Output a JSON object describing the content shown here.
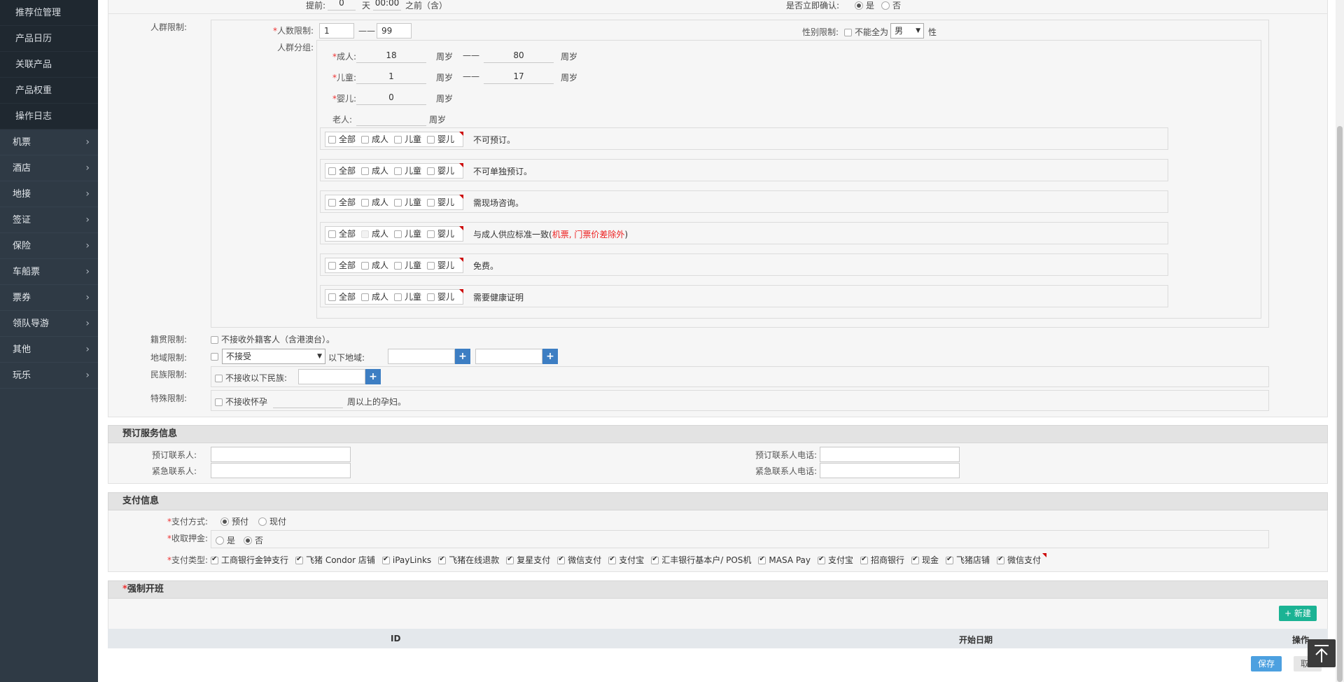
{
  "sidebar": {
    "sub_items": [
      "推荐位管理",
      "产品日历",
      "关联产品",
      "产品权重",
      "操作日志"
    ],
    "menu_items": [
      "机票",
      "酒店",
      "地接",
      "签证",
      "保险",
      "车船票",
      "票券",
      "领队导游",
      "其他",
      "玩乐"
    ],
    "chevron": "›"
  },
  "top_partial": {
    "advance_label": "提前:",
    "advance_days": "0",
    "day_unit": "天",
    "advance_time": "00:00",
    "before_text": "之前（含）",
    "confirm_label": "是否立即确认:",
    "yes": "是",
    "no": "否"
  },
  "crowd": {
    "label": "人群限制:",
    "people_limit_label": "人数限制:",
    "min": "1",
    "dash": "——",
    "max": "99",
    "gender_label": "性别限制:",
    "gender_text": "不能全为",
    "gender_value": "男",
    "gender_suffix": "性",
    "group_label": "人群分组:",
    "unit": "周岁",
    "groups": [
      {
        "label": "成人:",
        "from": "18",
        "to": "80",
        "required": true
      },
      {
        "label": "儿童:",
        "from": "1",
        "to": "17",
        "required": true
      },
      {
        "label": "婴儿:",
        "from": "0",
        "to": "",
        "required": true
      },
      {
        "label": "老人:",
        "from": "",
        "to": "",
        "required": false
      }
    ],
    "options": [
      "全部",
      "成人",
      "儿童",
      "婴儿"
    ],
    "rules": [
      {
        "text": "不可预订。",
        "extra": ""
      },
      {
        "text": "不可单独预订。",
        "extra": ""
      },
      {
        "text": "需现场咨询。",
        "extra": ""
      },
      {
        "text": "与成人供应标准一致(",
        "extra": "机票, 门票价差除外",
        "close": ")"
      },
      {
        "text": "免费。",
        "extra": ""
      },
      {
        "text": "需要健康证明",
        "extra": ""
      }
    ]
  },
  "nationality": {
    "label": "籍贯限制:",
    "text": "不接收外籍客人（含港澳台）。"
  },
  "region": {
    "label": "地域限制:",
    "select": "不接受",
    "text": "以下地域:"
  },
  "ethnic": {
    "label": "民族限制:",
    "text": "不接收以下民族:"
  },
  "special": {
    "label": "特殊限制:",
    "text": "不接收怀孕",
    "suffix": "周以上的孕妇。"
  },
  "booking": {
    "title": "预订服务信息",
    "contact_label": "预订联系人:",
    "emergency_label": "紧急联系人:",
    "contact_phone_label": "预订联系人电话:",
    "emergency_phone_label": "紧急联系人电话:"
  },
  "payment": {
    "title": "支付信息",
    "method_label": "支付方式:",
    "method_prepay": "预付",
    "method_cash": "现付",
    "deposit_label": "收取押金:",
    "deposit_yes": "是",
    "deposit_no": "否",
    "type_label": "支付类型:",
    "types": [
      "工商银行金钟支行",
      "飞猪 Condor 店铺",
      "iPayLinks",
      "飞猪在线退款",
      "复星支付",
      "微信支付",
      "支付宝",
      "汇丰银行基本户/ POS机",
      "MASA Pay",
      "支付宝",
      "招商银行",
      "现金",
      "飞猪店铺",
      "微信支付"
    ]
  },
  "forced": {
    "title": "强制开班",
    "new_button": "+ 新建",
    "col_id": "ID",
    "col_start": "开始日期",
    "col_action": "操作"
  },
  "footer": {
    "save": "保存",
    "cancel": "取消"
  },
  "totop_icon": "⤒"
}
